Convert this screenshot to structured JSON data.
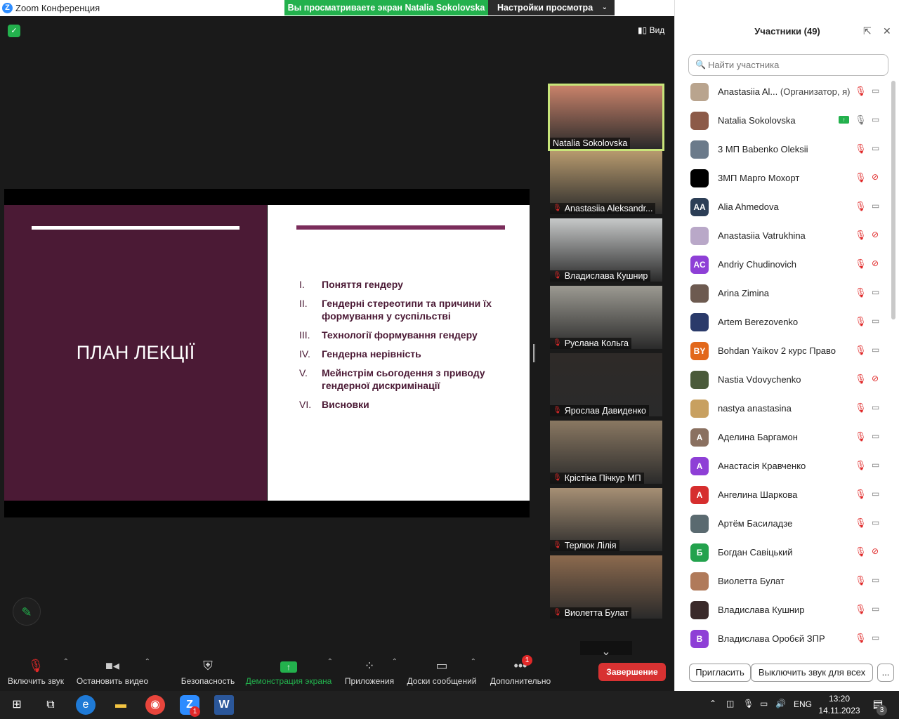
{
  "window": {
    "title": "Zoom Конференция"
  },
  "share_banner": {
    "viewing_text": "Вы просматриваете экран Natalia Sokolovska",
    "view_settings": "Настройки просмотра"
  },
  "window_controls": {
    "minimize": "—",
    "maximize": "⧉",
    "close": "✕"
  },
  "meeting": {
    "view_label": "Вид"
  },
  "slide": {
    "title": "ПЛАН ЛЕКЦІЇ",
    "items": [
      {
        "num": "I.",
        "text": "Поняття гендеру"
      },
      {
        "num": "II.",
        "text": "Гендерні стереотипи та причини їх формування у суспільстві"
      },
      {
        "num": "III.",
        "text": "Технології формування гендеру"
      },
      {
        "num": "IV.",
        "text": "Гендерна нерівність"
      },
      {
        "num": "V.",
        "text": "Мейнстрім сьогодення з приводу гендерної дискримінації"
      },
      {
        "num": "VI.",
        "text": "Висновки"
      }
    ]
  },
  "thumbnails": [
    {
      "name": "Natalia Sokolovska",
      "muted": false,
      "active": true,
      "bg": "#c9826a"
    },
    {
      "name": "Anastasiia Aleksandr...",
      "muted": true,
      "bg": "#b79a6e"
    },
    {
      "name": "Владислава Кушнир",
      "muted": true,
      "bg": "#c7c9c9"
    },
    {
      "name": "Руслана Кольга",
      "muted": true,
      "bg": "#9c9a92"
    },
    {
      "name": "Ярослав Давиденко",
      "muted": true,
      "bg": "#2e2a28"
    },
    {
      "name": "Крістіна Пічкур МП",
      "muted": true,
      "bg": "#8a7862"
    },
    {
      "name": "Терлюк Лілія",
      "muted": true,
      "bg": "#a68f74"
    },
    {
      "name": "Виолетта Булат",
      "muted": true,
      "bg": "#8c6a4e"
    }
  ],
  "toolbar": {
    "unmute": "Включить звук",
    "stop_video": "Остановить видео",
    "security": "Безопасность",
    "share_screen": "Демонстрация экрана",
    "apps": "Приложения",
    "whiteboards": "Доски сообщений",
    "more": "Дополнительно",
    "more_badge": "1",
    "end": "Завершение"
  },
  "participants": {
    "header": "Участники (49)",
    "search_placeholder": "Найти участника",
    "list": [
      {
        "name": "Anastasiia Al...",
        "role": "(Организатор, я)",
        "avatar": "",
        "color": "#b9a48e",
        "mic": "muted",
        "cam": "on"
      },
      {
        "name": "Natalia Sokolovska",
        "role": "",
        "avatar": "",
        "color": "#8c5a48",
        "mic": "on",
        "cam": "on",
        "sharing": true
      },
      {
        "name": "3 МП Babenko Oleksii",
        "role": "",
        "avatar": "",
        "color": "#6b7a8a",
        "mic": "muted",
        "cam": "on"
      },
      {
        "name": "3МП Марго Мохорт",
        "role": "",
        "avatar": "",
        "color": "#000000",
        "mic": "muted",
        "cam": "off"
      },
      {
        "name": "Alia Ahmedova",
        "role": "",
        "avatar": "AA",
        "color": "#2c3e56",
        "mic": "muted",
        "cam": "on"
      },
      {
        "name": "Anastasiia Vatrukhina",
        "role": "",
        "avatar": "",
        "color": "#b9a8c8",
        "mic": "muted",
        "cam": "off"
      },
      {
        "name": "Andriy Chudinovich",
        "role": "",
        "avatar": "AC",
        "color": "#8e3fd6",
        "mic": "muted",
        "cam": "off"
      },
      {
        "name": "Arina Zimina",
        "role": "",
        "avatar": "",
        "color": "#6d5a50",
        "mic": "muted",
        "cam": "on"
      },
      {
        "name": "Artem Berezovenko",
        "role": "",
        "avatar": "",
        "color": "#2a3a6a",
        "mic": "muted",
        "cam": "on"
      },
      {
        "name": "Bohdan Yaikov 2 курс Право",
        "role": "",
        "avatar": "BY",
        "color": "#e2681b",
        "mic": "muted",
        "cam": "on"
      },
      {
        "name": "Nastia Vdovychenko",
        "role": "",
        "avatar": "",
        "color": "#4a5a3a",
        "mic": "muted",
        "cam": "off"
      },
      {
        "name": "nastya anastasina",
        "role": "",
        "avatar": "",
        "color": "#c8a060",
        "mic": "muted",
        "cam": "on"
      },
      {
        "name": "Аделина Баргамон",
        "role": "",
        "avatar": "A",
        "color": "#8a7060",
        "mic": "muted",
        "cam": "on"
      },
      {
        "name": "Анастасія Кравченко",
        "role": "",
        "avatar": "A",
        "color": "#8e3fd6",
        "mic": "muted",
        "cam": "on"
      },
      {
        "name": "Ангелина Шаркова",
        "role": "",
        "avatar": "A",
        "color": "#d62e2e",
        "mic": "muted",
        "cam": "on"
      },
      {
        "name": "Артём Басиладзе",
        "role": "",
        "avatar": "",
        "color": "#5a6a70",
        "mic": "muted",
        "cam": "on"
      },
      {
        "name": "Богдан Савіцький",
        "role": "",
        "avatar": "Б",
        "color": "#23a24d",
        "mic": "muted",
        "cam": "off"
      },
      {
        "name": "Виолетта Булат",
        "role": "",
        "avatar": "",
        "color": "#b07a5a",
        "mic": "muted",
        "cam": "on"
      },
      {
        "name": "Владислава Кушнир",
        "role": "",
        "avatar": "",
        "color": "#3a2a2a",
        "mic": "muted",
        "cam": "on"
      },
      {
        "name": "Владислава Оробєй ЗПР",
        "role": "",
        "avatar": "B",
        "color": "#8e3fd6",
        "mic": "muted",
        "cam": "on"
      }
    ],
    "invite": "Пригласить",
    "mute_all": "Выключить звук для всех",
    "more": "..."
  },
  "taskbar": {
    "zoom_badge": "1",
    "word_label": "W",
    "lang": "ENG",
    "time": "13:20",
    "date": "14.11.2023",
    "notif_badge": "3"
  }
}
